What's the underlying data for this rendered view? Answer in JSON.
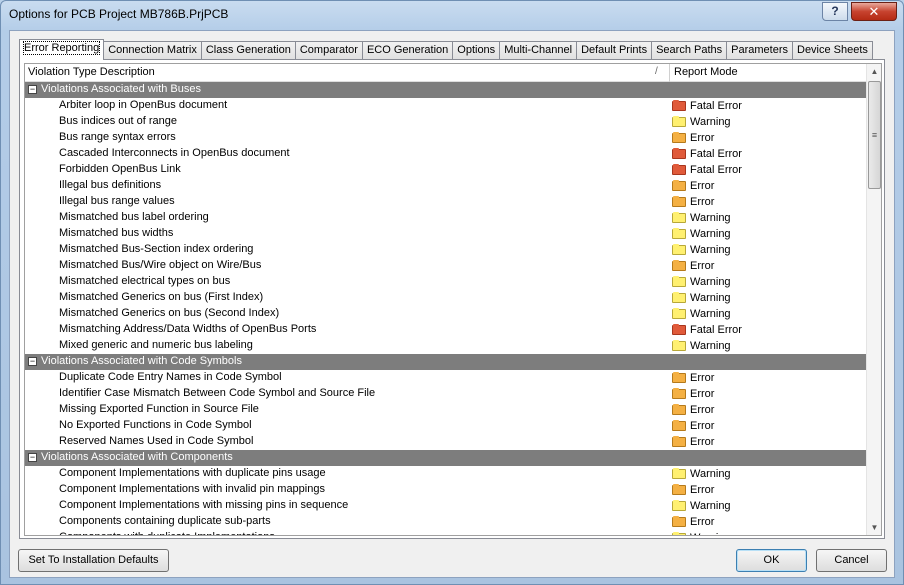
{
  "window": {
    "title": "Options for PCB Project MB786B.PrjPCB",
    "help_label": "?",
    "close_label": "✕"
  },
  "tabs": [
    {
      "label": "Error Reporting",
      "active": true
    },
    {
      "label": "Connection Matrix"
    },
    {
      "label": "Class Generation"
    },
    {
      "label": "Comparator"
    },
    {
      "label": "ECO Generation"
    },
    {
      "label": "Options"
    },
    {
      "label": "Multi-Channel"
    },
    {
      "label": "Default Prints"
    },
    {
      "label": "Search Paths"
    },
    {
      "label": "Parameters"
    },
    {
      "label": "Device Sheets"
    }
  ],
  "grid": {
    "col_description": "Violation Type Description",
    "col_mode": "Report Mode",
    "sort_indicator": "/",
    "groups": [
      {
        "label": "Violations Associated with Buses",
        "collapse": "−",
        "rows": [
          {
            "desc": "Arbiter loop in OpenBus document",
            "mode": "Fatal Error"
          },
          {
            "desc": "Bus indices out of range",
            "mode": "Warning"
          },
          {
            "desc": "Bus range syntax errors",
            "mode": "Error"
          },
          {
            "desc": "Cascaded Interconnects in OpenBus document",
            "mode": "Fatal Error"
          },
          {
            "desc": "Forbidden OpenBus Link",
            "mode": "Fatal Error"
          },
          {
            "desc": "Illegal bus definitions",
            "mode": "Error"
          },
          {
            "desc": "Illegal bus range values",
            "mode": "Error"
          },
          {
            "desc": "Mismatched bus label ordering",
            "mode": "Warning"
          },
          {
            "desc": "Mismatched bus widths",
            "mode": "Warning"
          },
          {
            "desc": "Mismatched Bus-Section index ordering",
            "mode": "Warning"
          },
          {
            "desc": "Mismatched Bus/Wire object on Wire/Bus",
            "mode": "Error"
          },
          {
            "desc": "Mismatched electrical types on bus",
            "mode": "Warning"
          },
          {
            "desc": "Mismatched Generics on bus (First Index)",
            "mode": "Warning"
          },
          {
            "desc": "Mismatched Generics on bus (Second Index)",
            "mode": "Warning"
          },
          {
            "desc": "Mismatching Address/Data Widths of OpenBus Ports",
            "mode": "Fatal Error"
          },
          {
            "desc": "Mixed generic and numeric bus labeling",
            "mode": "Warning"
          }
        ]
      },
      {
        "label": "Violations Associated with Code Symbols",
        "collapse": "−",
        "rows": [
          {
            "desc": "Duplicate Code Entry Names in Code Symbol",
            "mode": "Error"
          },
          {
            "desc": "Identifier Case Mismatch Between Code Symbol and Source File",
            "mode": "Error"
          },
          {
            "desc": "Missing Exported Function in Source File",
            "mode": "Error"
          },
          {
            "desc": "No Exported Functions in Code Symbol",
            "mode": "Error"
          },
          {
            "desc": "Reserved Names Used in Code Symbol",
            "mode": "Error"
          }
        ]
      },
      {
        "label": "Violations Associated with Components",
        "collapse": "−",
        "rows": [
          {
            "desc": "Component Implementations with duplicate pins usage",
            "mode": "Warning"
          },
          {
            "desc": "Component Implementations with invalid pin mappings",
            "mode": "Error"
          },
          {
            "desc": "Component Implementations with missing pins in sequence",
            "mode": "Warning"
          },
          {
            "desc": "Components containing duplicate sub-parts",
            "mode": "Error"
          },
          {
            "desc": "Components with duplicate Implementations",
            "mode": "Warning"
          }
        ]
      }
    ]
  },
  "scrollbar": {
    "up": "▲",
    "down": "▼",
    "grip": "≡"
  },
  "buttons": {
    "defaults": "Set To Installation Defaults",
    "ok": "OK",
    "cancel": "Cancel"
  },
  "colors": {
    "fatal": "#e05a3a",
    "warning": "#fff070",
    "error": "#f4b043",
    "group_bg": "#7d7d7d"
  }
}
